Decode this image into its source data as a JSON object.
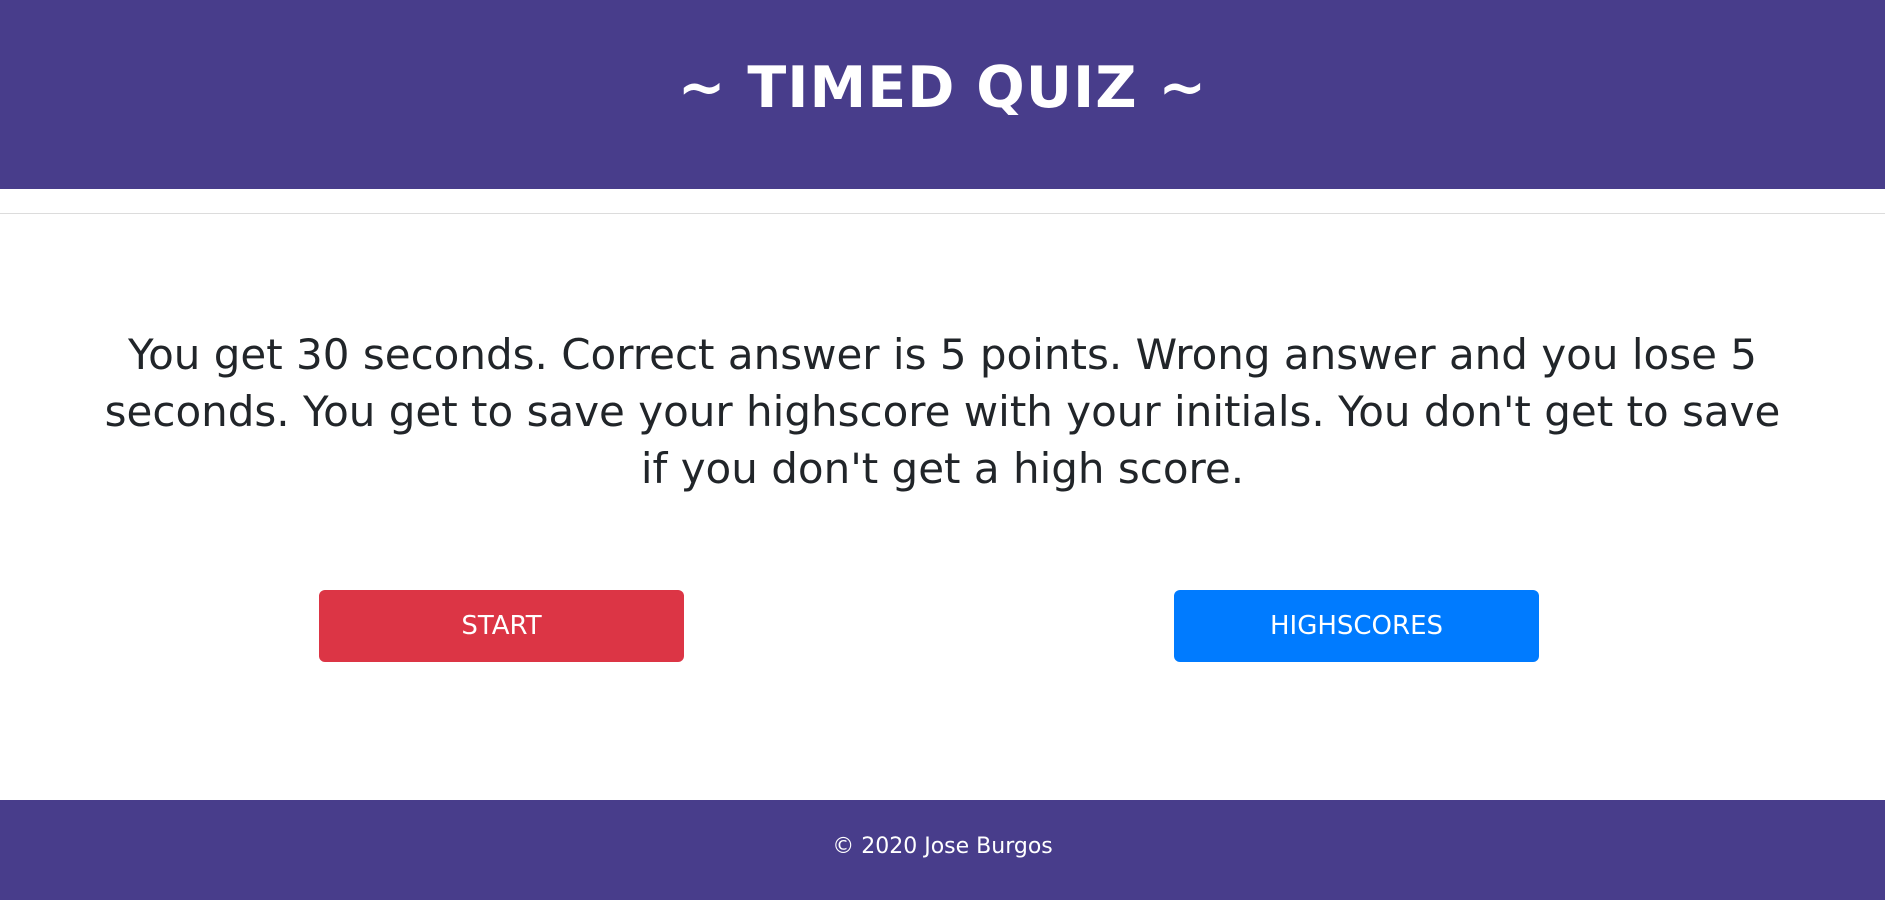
{
  "header": {
    "title": "~ TIMED QUIZ ~"
  },
  "main": {
    "instructions": "You get 30 seconds. Correct answer is 5 points. Wrong answer and you lose 5 seconds. You get to save your highscore with your initials. You don't get to save if you don't get a high score.",
    "start_label": "START",
    "highscores_label": "HIGHSCORES"
  },
  "footer": {
    "text": "© 2020 Jose Burgos"
  },
  "colors": {
    "header_bg": "#483d8b",
    "footer_bg": "#483d8b",
    "start_button": "#dc3545",
    "highscores_button": "#007bff",
    "text": "#212529"
  }
}
